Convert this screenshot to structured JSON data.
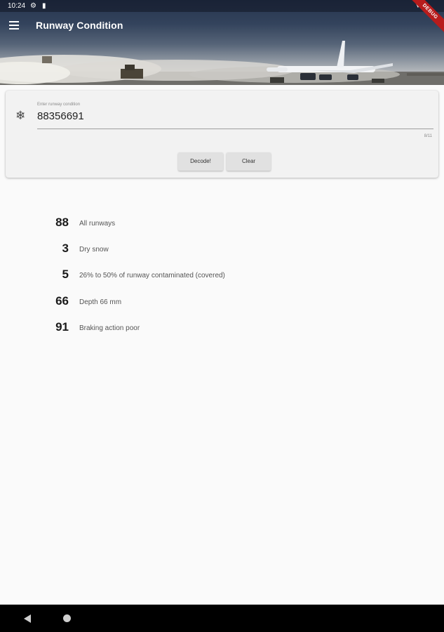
{
  "status_bar": {
    "time": "10:24",
    "icons": [
      "gear-icon",
      "sim-card-icon",
      "wifi-icon",
      "battery-icon"
    ]
  },
  "app_bar": {
    "title": "Runway Condition",
    "menu_icon": "menu-icon",
    "debug_banner": "DEBUG"
  },
  "input_card": {
    "icon": "snowflake-icon",
    "field_label": "Enter runway condition",
    "value": "88356691",
    "counter": "8/11",
    "decode_label": "Decode!",
    "clear_label": "Clear"
  },
  "results": [
    {
      "code": "88",
      "description": "All runways"
    },
    {
      "code": "3",
      "description": "Dry snow"
    },
    {
      "code": "5",
      "description": "26% to 50% of runway contaminated (covered)"
    },
    {
      "code": "66",
      "description": "Depth 66 mm"
    },
    {
      "code": "91",
      "description": "Braking action poor"
    }
  ],
  "colors": {
    "background": "#fafafa",
    "card": "#f2f2f2",
    "button": "#e1e1e1",
    "debug_banner": "#b71c1c"
  }
}
